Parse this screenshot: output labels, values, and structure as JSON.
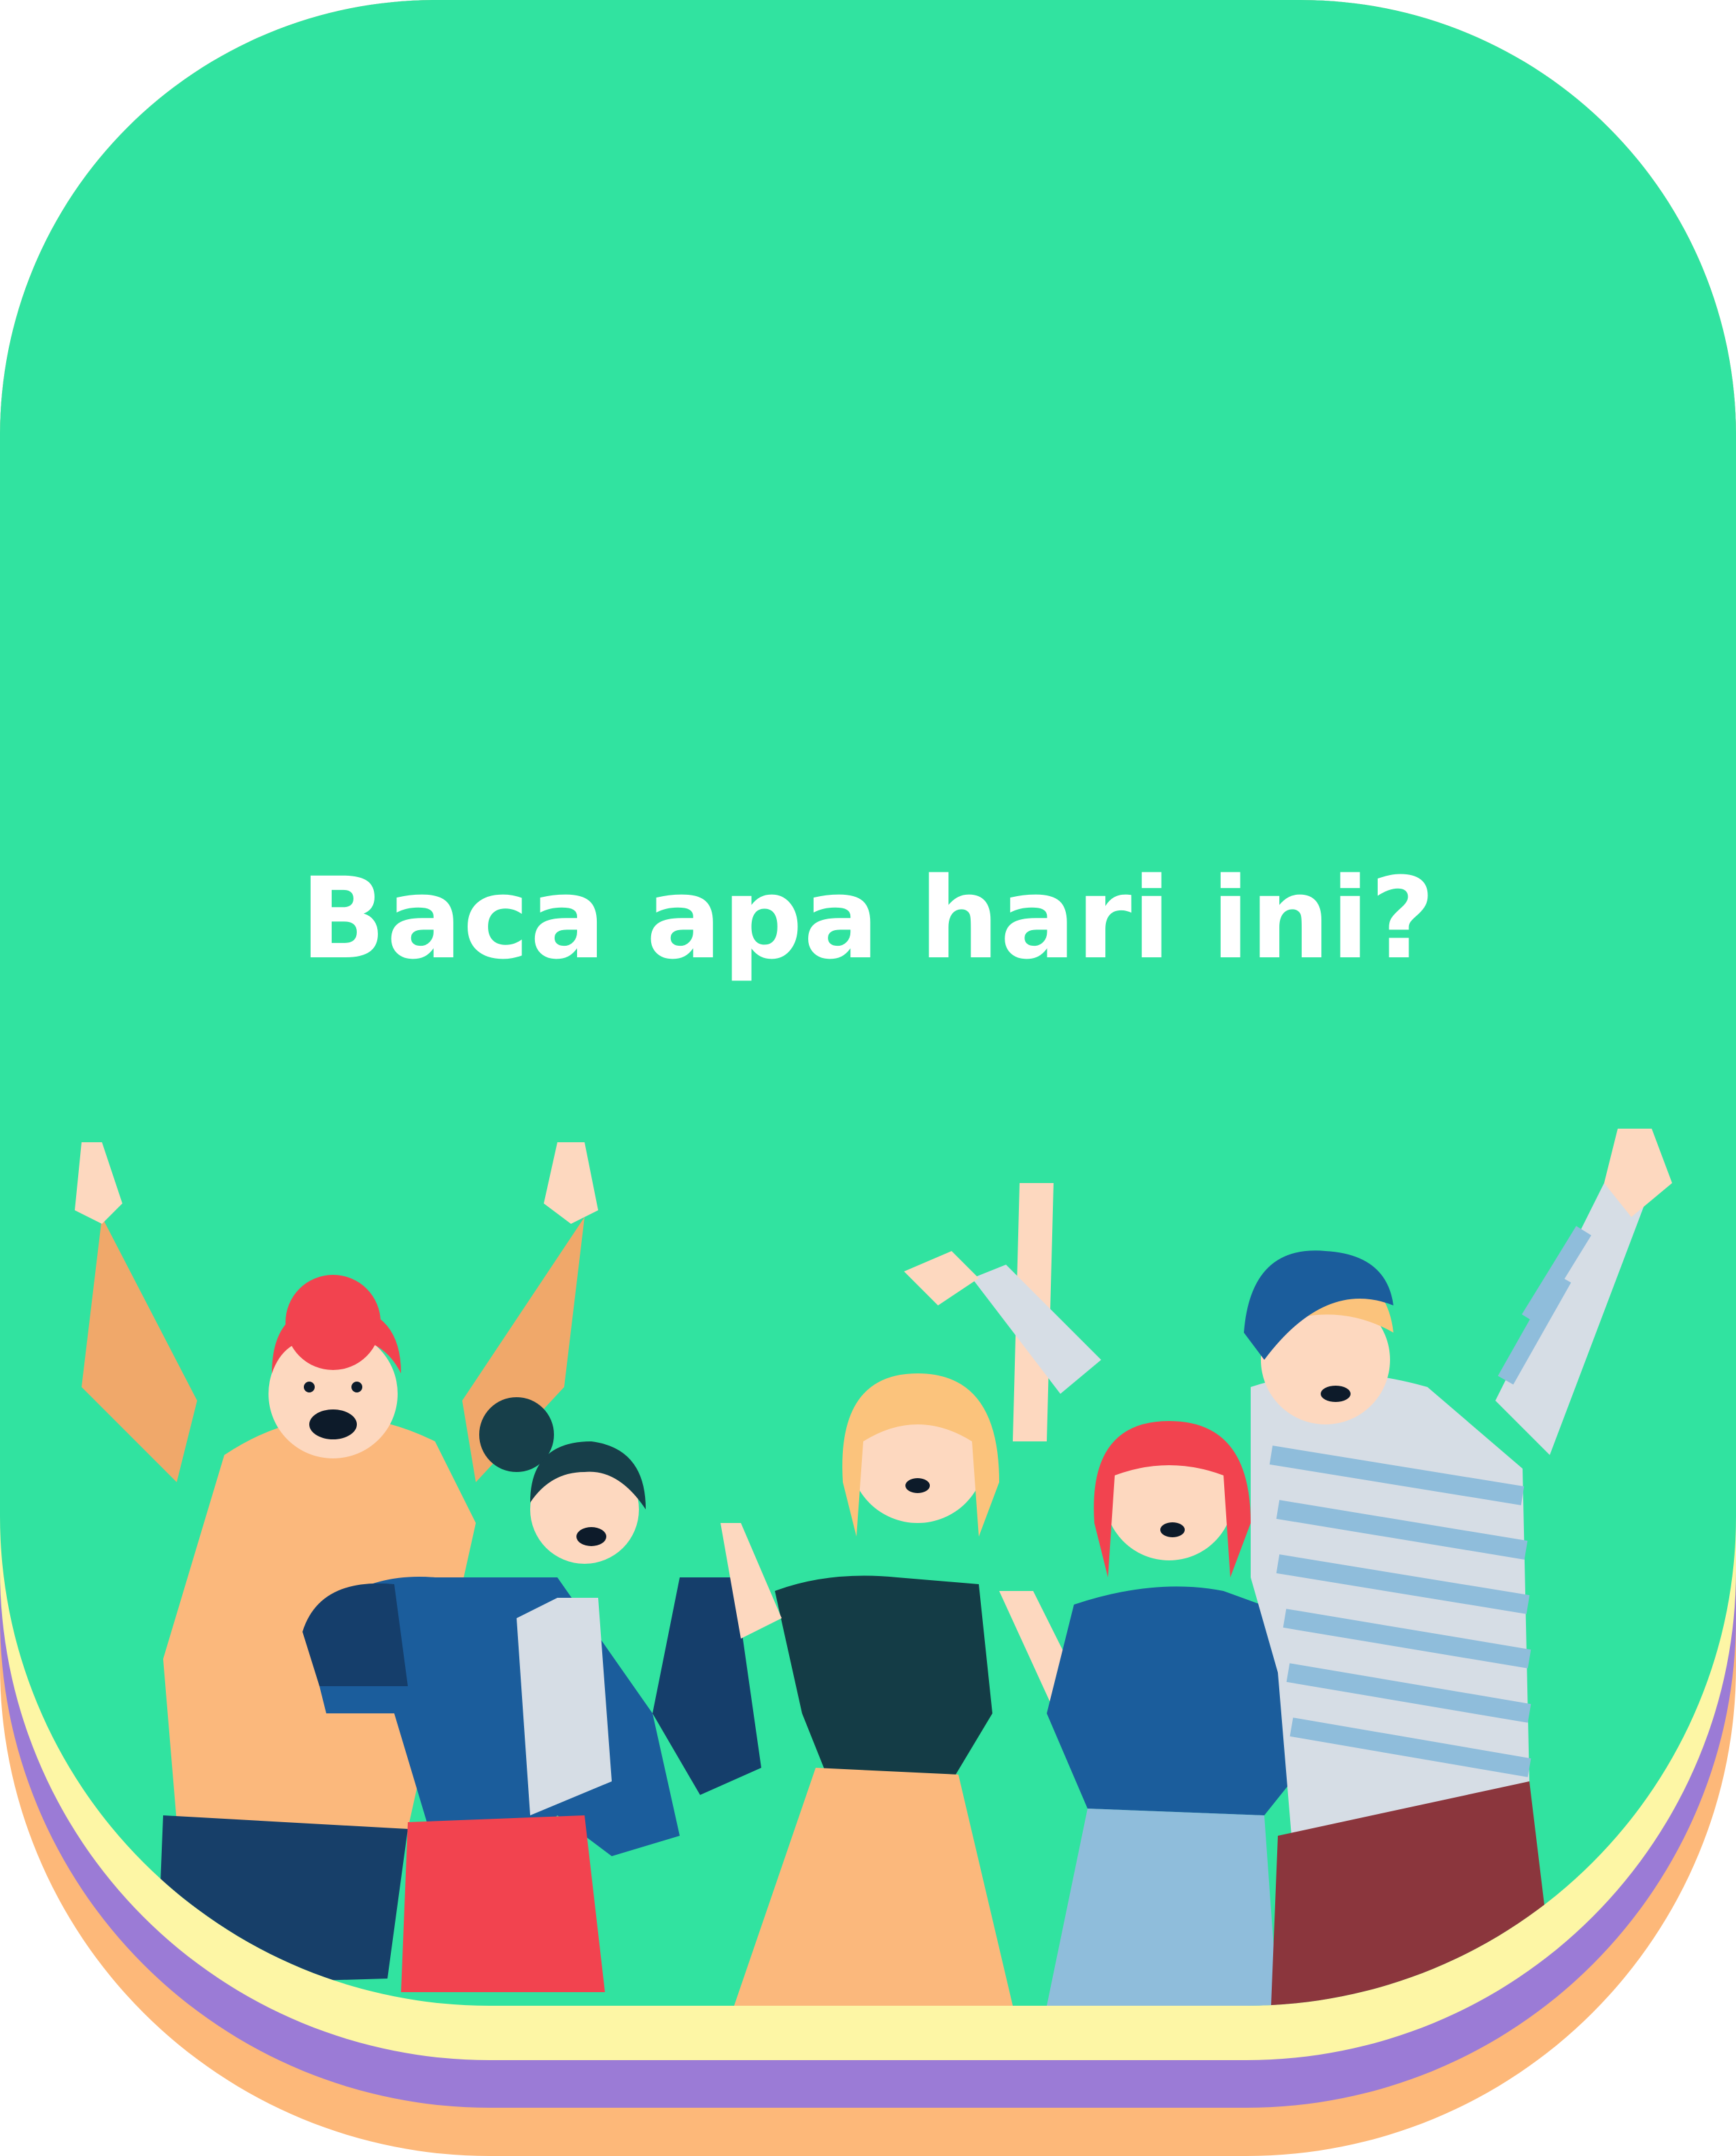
{
  "headline": "Baca apa hari ini?",
  "colors": {
    "card": "#31e3a0",
    "stack_yellow": "#fdf6a5",
    "stack_purple": "#9b7bd6",
    "stack_orange": "#fdb879",
    "text": "#ffffff"
  },
  "illustration": {
    "subject": "group-of-five-cheering-people",
    "icon": "people-illustration"
  }
}
